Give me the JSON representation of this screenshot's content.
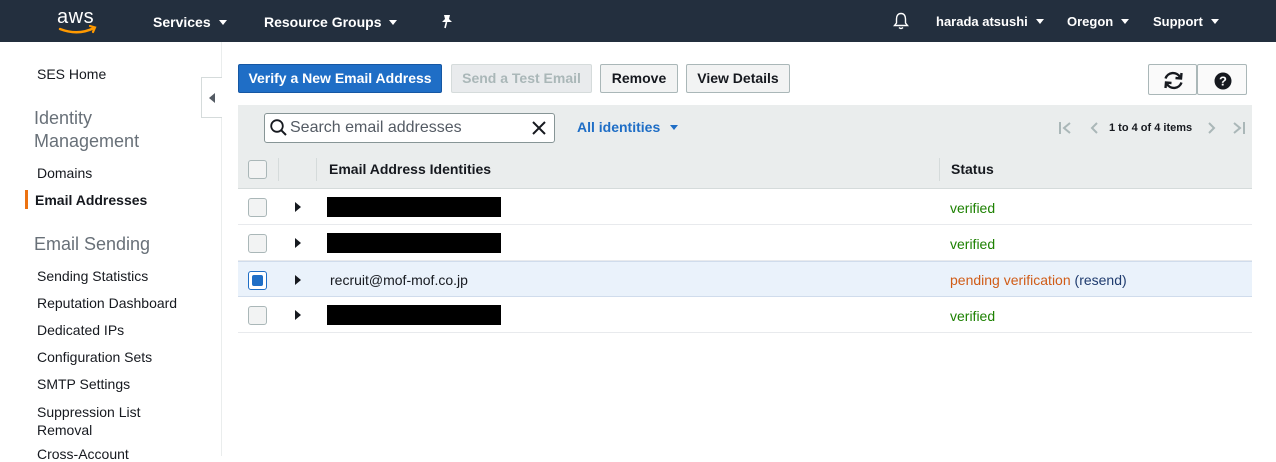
{
  "topnav": {
    "brand": "aws",
    "services": "Services",
    "resource_groups": "Resource Groups",
    "user": "harada atsushi",
    "region": "Oregon",
    "support": "Support"
  },
  "sidebar": {
    "home": "SES Home",
    "identity_heading": "Identity Management",
    "domains": "Domains",
    "email_addresses": "Email Addresses",
    "sending_heading": "Email Sending",
    "sending_statistics": "Sending Statistics",
    "reputation_dashboard": "Reputation Dashboard",
    "dedicated_ips": "Dedicated IPs",
    "configuration_sets": "Configuration Sets",
    "smtp_settings": "SMTP Settings",
    "suppression_list": "Suppression List Removal",
    "cross_account": "Cross-Account"
  },
  "toolbar": {
    "verify": "Verify a New Email Address",
    "send_test": "Send a Test Email",
    "remove": "Remove",
    "view_details": "View Details"
  },
  "filter": {
    "search_placeholder": "Search email addresses",
    "dropdown": "All identities",
    "pager_text": "1 to 4 of 4 items"
  },
  "table": {
    "col_email": "Email Address Identities",
    "col_status": "Status",
    "rows": [
      {
        "email": "",
        "redacted": true,
        "status": "verified",
        "checked": false
      },
      {
        "email": "",
        "redacted": true,
        "status": "verified",
        "checked": false
      },
      {
        "email": "recruit@mof-mof.co.jp",
        "redacted": false,
        "status": "pending verification",
        "resend": "(resend)",
        "checked": true
      },
      {
        "email": "",
        "redacted": true,
        "status": "verified",
        "checked": false
      }
    ]
  },
  "colors": {
    "nav_bg": "#232f3e",
    "primary": "#1f6ec6",
    "verified": "#1d8102",
    "pending": "#d05c17",
    "active_marker": "#ec7211"
  }
}
